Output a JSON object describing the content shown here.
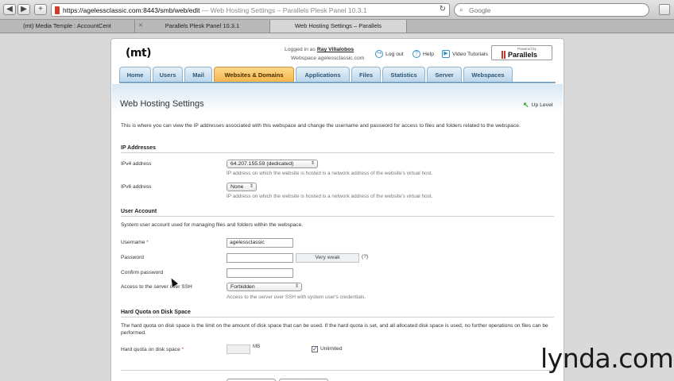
{
  "browser": {
    "url_main": "https://agelessclassic.com:8443/smb/web/edit",
    "url_dim": " — Web Hosting Settings – Parallels Plesk Panel 10.3.1",
    "search_placeholder": "Google",
    "tabs": [
      {
        "label": "(mt) Media Temple : AccountCent",
        "active": false
      },
      {
        "label": "Parallels Plesk Panel 10.3.1",
        "active": false
      },
      {
        "label": "Web Hosting Settings – Parallels",
        "active": true
      }
    ]
  },
  "header": {
    "logo": "(mt)",
    "logged_in_prefix": "Logged in as",
    "logged_in_user": "Ray Villalobos",
    "webspace": "Webspace agelessclassic.com",
    "logout": "Log out",
    "help": "Help",
    "video": "Video Tutorials",
    "powered_by": "Powered by",
    "brand": "Parallels"
  },
  "nav": [
    {
      "label": "Home",
      "active": false
    },
    {
      "label": "Users",
      "active": false
    },
    {
      "label": "Mail",
      "active": false
    },
    {
      "label": "Websites & Domains",
      "active": true
    },
    {
      "label": "Applications",
      "active": false
    },
    {
      "label": "Files",
      "active": false
    },
    {
      "label": "Statistics",
      "active": false
    },
    {
      "label": "Server",
      "active": false
    },
    {
      "label": "Webspaces",
      "active": false
    }
  ],
  "page": {
    "title": "Web Hosting Settings",
    "up_level": "Up Level",
    "intro": "This is where you can view the IP addresses associated with this webspace and change the username and password for access to files and folders related to the webspace."
  },
  "ip": {
    "heading": "IP Addresses",
    "ipv4_label": "IPv4 address",
    "ipv4_value": "64.207.155.59 (dedicated)",
    "ipv4_hint": "IP address on which the website is hosted is a network address of the website's virtual host.",
    "ipv6_label": "IPv6 address",
    "ipv6_value": "None",
    "ipv6_hint": "IP address on which the website is hosted is a network address of the website's virtual host."
  },
  "account": {
    "heading": "User Account",
    "desc": "System user account used for managing files and folders within the webspace.",
    "username_label": "Username",
    "username_value": "agelessclassic",
    "password_label": "Password",
    "strength": "Very weak",
    "help_mark": "(?)",
    "confirm_label": "Confirm password",
    "ssh_label": "Access to the server over SSH",
    "ssh_value": "Forbidden",
    "ssh_hint": "Access to the server over SSH with system user's credentials."
  },
  "quota": {
    "heading": "Hard Quota on Disk Space",
    "desc": "The hard quota on disk space is the limit on the amount of disk space that can be used. If the hard quota is set, and all allocated disk space is used, no further operations on files can be performed.",
    "label": "Hard quota on disk space",
    "unit": "MB",
    "unlimited_label": "Unlimited",
    "unlimited_checked": true
  },
  "watermark": {
    "brand": "lynda",
    "suffix": ".com"
  }
}
